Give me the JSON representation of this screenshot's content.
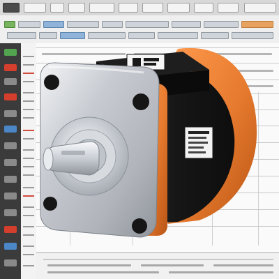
{
  "scene": {
    "subject": "servo motor",
    "colors": {
      "housing_orange": "#e67a2e",
      "motor_body_dark": "#1f1f1f",
      "flange_silver": "#b8bcc2",
      "shaft_silver": "#d7dbe0",
      "ui_background": "#e9e9e9"
    }
  }
}
